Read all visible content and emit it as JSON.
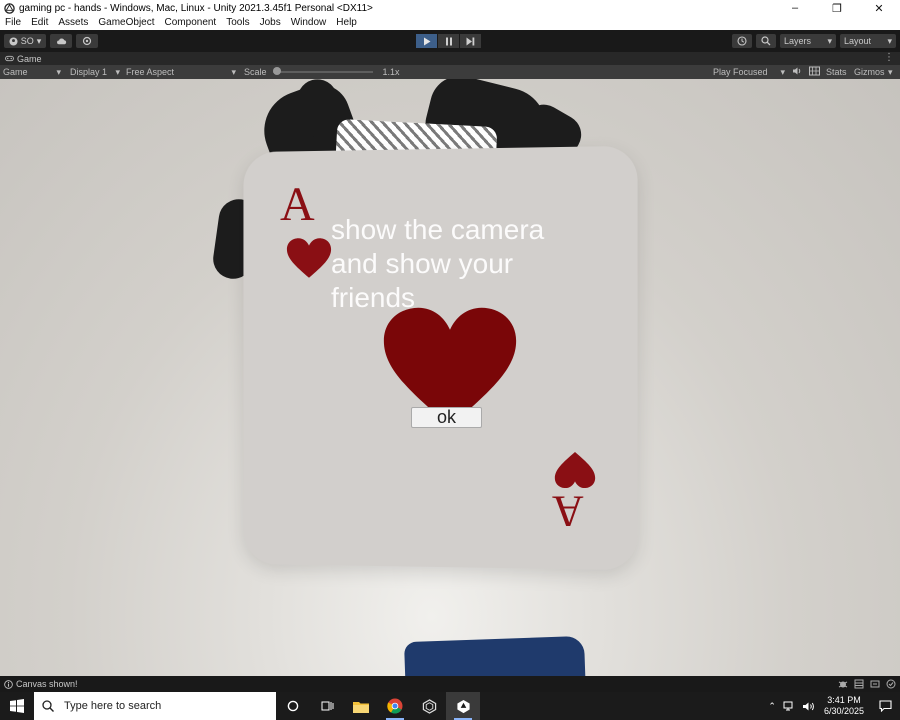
{
  "window": {
    "title": "gaming pc - hands - Windows, Mac, Linux - Unity 2021.3.45f1 Personal <DX11>",
    "controls": {
      "minimize": "–",
      "maximize": "❐",
      "close": "✕"
    }
  },
  "menu": {
    "items": [
      "File",
      "Edit",
      "Assets",
      "GameObject",
      "Component",
      "Tools",
      "Jobs",
      "Window",
      "Help"
    ]
  },
  "toolbar": {
    "account_label": "SO",
    "layers_label": "Layers",
    "layout_label": "Layout",
    "accent_color": "#3d5f8a"
  },
  "game_tab": {
    "label": "Game"
  },
  "game_controls": {
    "mode": "Game",
    "display": "Display 1",
    "aspect": "Free Aspect",
    "scale_label": "Scale",
    "scale_value": "1.1x",
    "play_mode": "Play Focused",
    "stats": "Stats",
    "gizmos": "Gizmos"
  },
  "scene": {
    "card_rank": "A",
    "card_message": "show the camera and show your friends",
    "ok_label": "ok",
    "suit_color": "#8a0f14"
  },
  "status": {
    "text": "Canvas shown!"
  },
  "taskbar": {
    "search_placeholder": "Type here to search",
    "time": "3:41 PM",
    "date": "6/30/2025"
  }
}
